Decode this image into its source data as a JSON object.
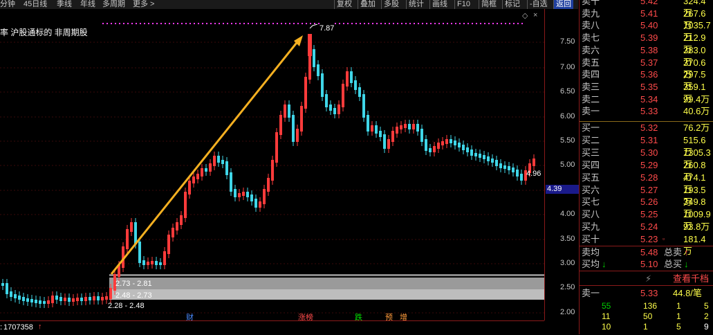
{
  "toolbar": {
    "left_items": [
      "分钟",
      "45日线",
      "季线",
      "年线",
      "多周期",
      "更多 >"
    ],
    "right_items": [
      "复权",
      "叠加",
      "多股",
      "统计",
      "画线",
      "F10",
      "简框",
      "标记",
      "-自选",
      "返回"
    ]
  },
  "chart": {
    "indicator_label": "率 沪股通标的 非周期股",
    "peak_label": "7.87",
    "right_label": "4.96",
    "zones": [
      "2.73 - 2.81",
      "2.48 - 2.73",
      "2.28 - 2.48"
    ],
    "events": [
      "财",
      "涨榜",
      "跌",
      "预",
      "增"
    ],
    "bottom_value": "1707358",
    "price_tag": "4.39",
    "y_ticks": [
      "7.50",
      "7.00",
      "6.50",
      "6.00",
      "5.50",
      "5.00",
      "4.50",
      "4.00",
      "3.50",
      "3.00",
      "2.50",
      "2.00"
    ]
  },
  "order_book": {
    "sell": [
      {
        "label": "卖十",
        "price": "5.42",
        "vol": "324.4万"
      },
      {
        "label": "卖九",
        "price": "5.41",
        "vol": "267.6万"
      },
      {
        "label": "卖八",
        "price": "5.40",
        "vol": "1035.7万"
      },
      {
        "label": "卖七",
        "price": "5.39",
        "vol": "212.9万"
      },
      {
        "label": "卖六",
        "price": "5.38",
        "vol": "383.0万"
      },
      {
        "label": "卖五",
        "price": "5.37",
        "vol": "370.6万"
      },
      {
        "label": "卖四",
        "price": "5.36",
        "vol": "297.5万"
      },
      {
        "label": "卖三",
        "price": "5.35",
        "vol": "359.1万"
      },
      {
        "label": "卖二",
        "price": "5.34",
        "vol": "99.4万"
      },
      {
        "label": "卖一",
        "price": "5.33",
        "vol": "40.6万"
      }
    ],
    "buy": [
      {
        "label": "买一",
        "price": "5.32",
        "vol": "76.2万"
      },
      {
        "label": "买二",
        "price": "5.31",
        "vol": "515.6万"
      },
      {
        "label": "买三",
        "price": "5.30",
        "vol": "1305.3万"
      },
      {
        "label": "买四",
        "price": "5.29",
        "vol": "260.8万"
      },
      {
        "label": "买五",
        "price": "5.28",
        "vol": "474.1万"
      },
      {
        "label": "买六",
        "price": "5.27",
        "vol": "193.5万"
      },
      {
        "label": "买七",
        "price": "5.26",
        "vol": "349.8万"
      },
      {
        "label": "买八",
        "price": "5.25",
        "vol": "1009.9万"
      },
      {
        "label": "买九",
        "price": "5.24",
        "vol": "93.8万"
      },
      {
        "label": "买十",
        "price": "5.23",
        "vol": "181.4万"
      }
    ],
    "avg_sell_label": "卖均",
    "avg_sell": "5.48",
    "total_sell_label": "总卖",
    "avg_buy_label": "买均",
    "avg_buy": "5.10",
    "total_buy_label": "总买",
    "view_thousand": "查看千档",
    "sell_one_label": "卖一",
    "sell_one_price": "5.33",
    "per_trade": "44.8/笔",
    "grid": [
      [
        "55",
        "136",
        "1",
        "5"
      ],
      [
        "11",
        "50",
        "1",
        "2"
      ],
      [
        "10",
        "1",
        "5",
        "9"
      ]
    ]
  },
  "colors": {
    "up": "#ff3b3b",
    "down": "#3fd6e8",
    "accent": "#f5b021",
    "magenta": "#ff3bff"
  }
}
